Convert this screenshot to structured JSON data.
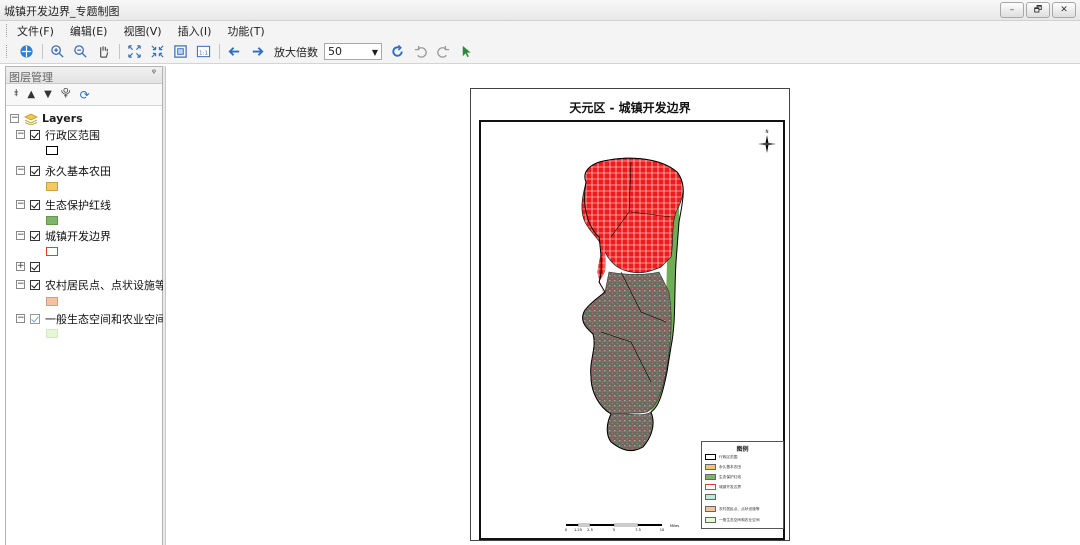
{
  "window": {
    "title": "城镇开发边界_专题制图",
    "buttons": [
      "–",
      "🗗",
      "✕"
    ]
  },
  "menu": [
    "文件(F)",
    "编辑(E)",
    "视图(V)",
    "插入(I)",
    "功能(T)"
  ],
  "toolbar": {
    "zoom_label": "放大倍数",
    "zoom_value": "50"
  },
  "layers_panel": {
    "title": "图层管理",
    "pin": "ᵠ",
    "root": "Layers",
    "items": [
      {
        "label": "行政区范围",
        "swatch": "#ffffff",
        "outline": "#000000"
      },
      {
        "label": "永久基本农田",
        "swatch": "#f5c862",
        "outline": "#c9a13e"
      },
      {
        "label": "生态保护红线",
        "swatch": "#7fb56a",
        "outline": "#5f9a4c"
      },
      {
        "label": "城镇开发边界",
        "swatch": "#ffffff",
        "outline": "#e53b3b"
      },
      {
        "label": "",
        "swatch": null,
        "outline": null
      },
      {
        "label": "农村居民点、点状设施等",
        "swatch": "#f2c3a0",
        "outline": "#d69e7a"
      },
      {
        "label": "一般生态空间和农业空间",
        "swatch": "#e4f8d6",
        "outline": "#d0ecc0"
      }
    ]
  },
  "map": {
    "title": "天元区 - 城镇开发边界",
    "legend_title": "图例",
    "legend_items": [
      {
        "label": "行政区范围",
        "color": "#ffffff"
      },
      {
        "label": "永久基本农田",
        "color": "#f5c862"
      },
      {
        "label": "生态保护红线",
        "color": "#7fb56a"
      },
      {
        "label": "城镇开发边界",
        "color": "#ffffff"
      },
      {
        "label": "",
        "color": "#b8ecdc"
      },
      {
        "label": "农村居民点、点状设施等",
        "color": "#f2c3a0"
      },
      {
        "label": "一般生态空间和农业空间",
        "color": "#e4f8d6"
      }
    ],
    "scale_labels": [
      "0",
      "1.25",
      "2.5",
      "5",
      "7.5",
      "10"
    ],
    "scale_unit": "Miles",
    "north_label": "N"
  }
}
